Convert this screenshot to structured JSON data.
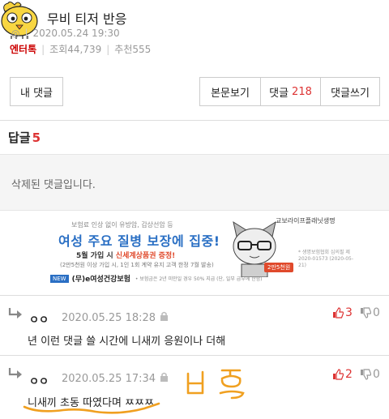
{
  "post": {
    "title": "무비 티저 반응",
    "author_hint": "◎",
    "datetime": "2020.05.24 19:30",
    "category": "엔터톡",
    "views": "조회44,739",
    "recommends": "추천555"
  },
  "buttons": {
    "my_comments": "내 댓글",
    "view_body": "본문보기",
    "comments_label": "댓글",
    "comments_count": "218",
    "write_comment": "댓글쓰기"
  },
  "replies": {
    "label": "답글",
    "count": "5"
  },
  "deleted_text": "삭제된 댓글입니다.",
  "ad": {
    "line1": "보험료 인상 없이 유방암, 갑상선암 등",
    "headline": "여성 주요 질병 보장에 집중!",
    "promo_prefix": "5월 가입 시",
    "promo_highlight": "신세계상품권 증정!",
    "promo_note": "(2만5천원 이상 가입 시, 1인 1회 계약 유지 고객 한정 7월 발송)",
    "new_badge": "NEW",
    "product": "(무)e여성건강보험",
    "product_note": "• 보험금은 2년 미만일 경우 50% 지급 (단, 일부 급부에 한함)",
    "brand": "교보라이프플래닛생명",
    "coupon": "2만5천원",
    "legal": "* 생명보험협회 심의필 제2020-01573 (2020-05-21)"
  },
  "comments": [
    {
      "nick": "ㅇㅇ",
      "date": "2020.05.25 18:28",
      "text": "년 이런 댓글 쓸 시간에 니새끼 응원이나 더해",
      "up": "3",
      "down": "0"
    },
    {
      "nick": "ㅇㅇ",
      "date": "2020.05.25 17:34",
      "text": "니새끼 초동 따였다며 ㅉㅉㅉ",
      "up": "2",
      "down": "0"
    }
  ],
  "colors": {
    "accent_red": "#d33333",
    "annotation_orange": "#f0a020",
    "ad_blue": "#2a6fc4"
  }
}
